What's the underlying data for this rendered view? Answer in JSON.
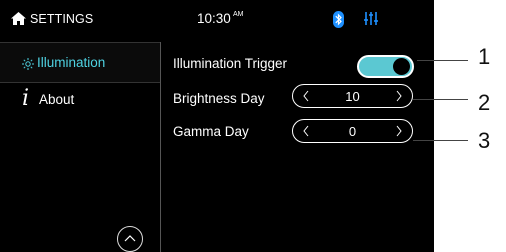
{
  "status_bar": {
    "title": "SETTINGS",
    "time": "10:30",
    "ampm": "AM"
  },
  "sidebar": {
    "items": [
      {
        "label": "Illumination",
        "icon": "sun-icon",
        "selected": true
      },
      {
        "label": "About",
        "icon": "info-icon",
        "selected": false
      }
    ]
  },
  "settings": {
    "illumination_trigger": {
      "label": "Illumination Trigger",
      "on": true
    },
    "brightness_day": {
      "label": "Brightness Day",
      "value": "10"
    },
    "gamma_day": {
      "label": "Gamma Day",
      "value": "0"
    }
  },
  "callouts": [
    "1",
    "2",
    "3"
  ],
  "colors": {
    "accent": "#4fd3e3",
    "toggle": "#5bc8d2",
    "background": "#000000",
    "bluetooth": "#1e90ff"
  }
}
